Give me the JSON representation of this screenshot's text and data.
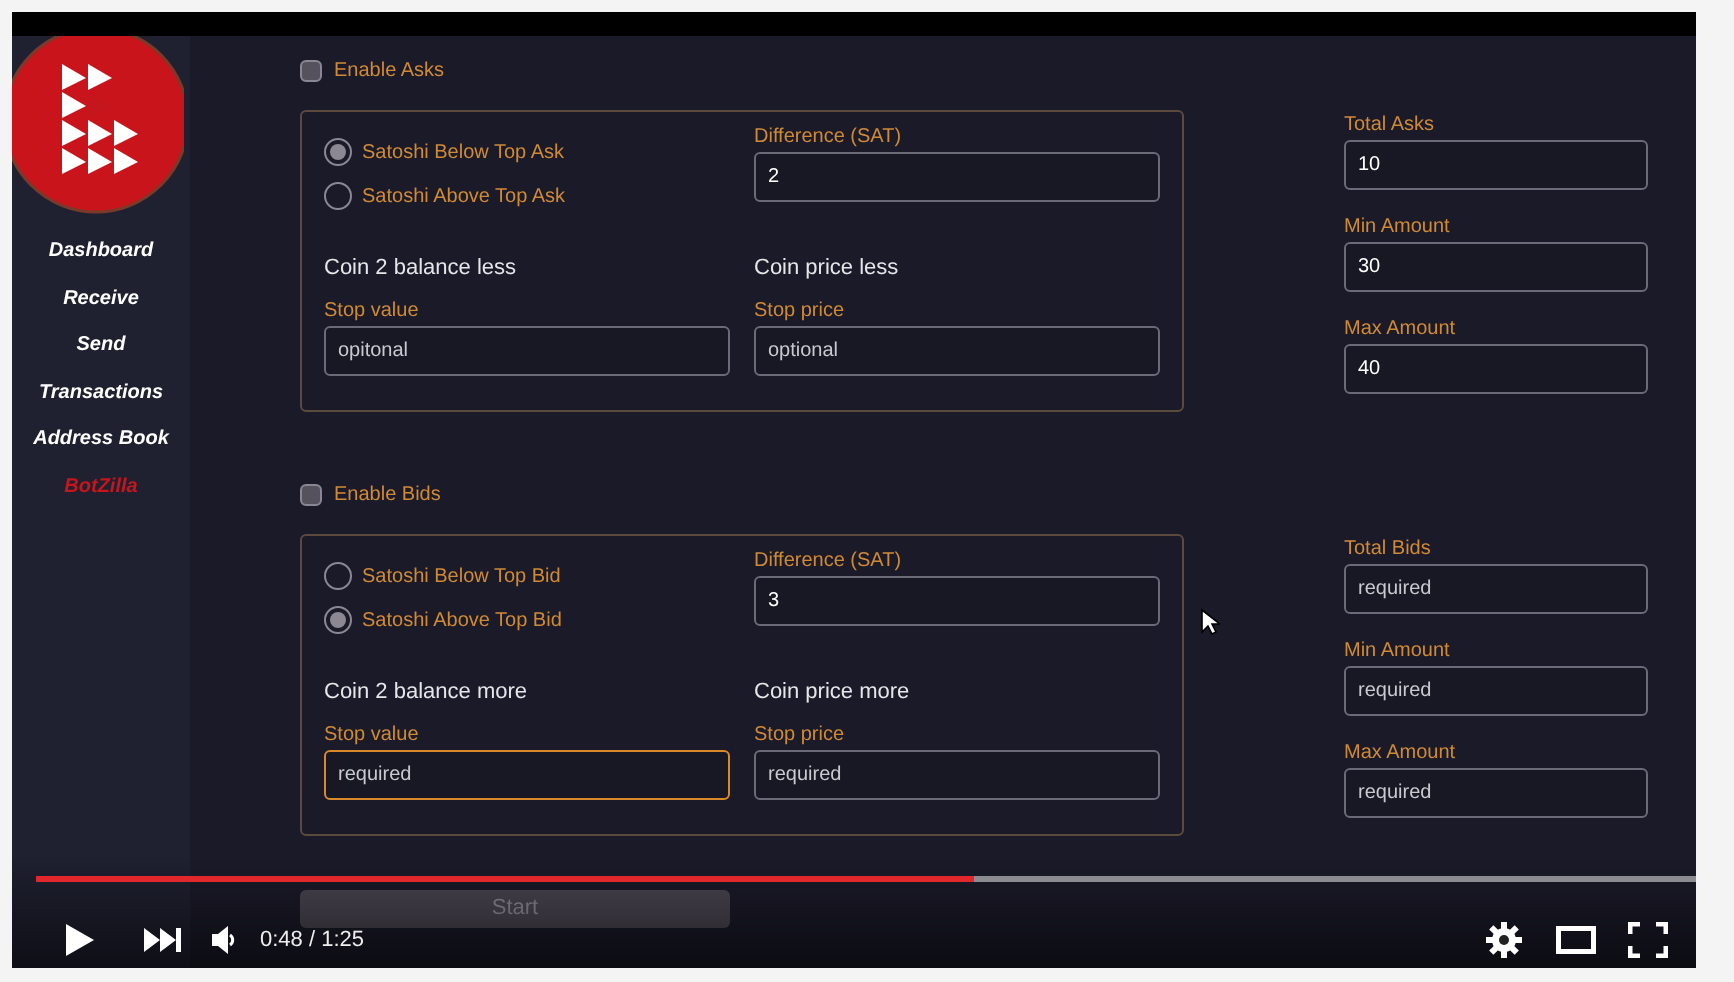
{
  "sidebar": {
    "items": [
      {
        "label": "Dashboard",
        "selected": false
      },
      {
        "label": "Receive",
        "selected": false
      },
      {
        "label": "Send",
        "selected": false
      },
      {
        "label": "Transactions",
        "selected": false
      },
      {
        "label": "Address Book",
        "selected": false
      },
      {
        "label": "BotZilla",
        "selected": true
      }
    ]
  },
  "sections": [
    {
      "enable": {
        "label": "Enable Asks",
        "checked": false
      },
      "options": [
        {
          "label": "Satoshi Below Top Ask",
          "selected": true
        },
        {
          "label": "Satoshi Above Top Ask",
          "selected": false
        }
      ],
      "difference": {
        "label": "Difference (SAT)",
        "value": "2",
        "focused": false
      },
      "stops": [
        {
          "heading": "Coin 2 balance less",
          "label": "Stop value",
          "placeholder": "opitonal",
          "focused": false
        },
        {
          "heading": "Coin price less",
          "label": "Stop price",
          "placeholder": "optional",
          "focused": false
        }
      ],
      "side_fields": [
        {
          "label": "Total Asks",
          "value": "10",
          "focused": false
        },
        {
          "label": "Min Amount",
          "value": "30",
          "focused": false
        },
        {
          "label": "Max Amount",
          "value": "40",
          "focused": false
        }
      ]
    },
    {
      "enable": {
        "label": "Enable Bids",
        "checked": false
      },
      "options": [
        {
          "label": "Satoshi Below Top Bid",
          "selected": false
        },
        {
          "label": "Satoshi Above Top Bid",
          "selected": true
        }
      ],
      "difference": {
        "label": "Difference (SAT)",
        "value": "3",
        "focused": false
      },
      "stops": [
        {
          "heading": "Coin 2 balance more",
          "label": "Stop value",
          "placeholder": "required",
          "focused": true
        },
        {
          "heading": "Coin price more",
          "label": "Stop price",
          "placeholder": "required",
          "focused": false
        }
      ],
      "side_fields": [
        {
          "label": "Total Bids",
          "placeholder": "required",
          "focused": false
        },
        {
          "label": "Min Amount",
          "placeholder": "required",
          "focused": false
        },
        {
          "label": "Max Amount",
          "placeholder": "required",
          "focused": false
        }
      ]
    }
  ],
  "start_button": "Start",
  "player": {
    "progress": {
      "level": 0.565
    },
    "time": "0:48 / 1:25"
  }
}
